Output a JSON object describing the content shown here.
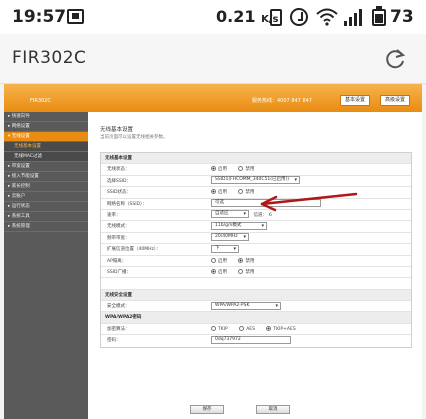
{
  "status_bar": {
    "time": "19:57",
    "speed_value": "0.21",
    "speed_unit": "K/s",
    "battery_percent": "73"
  },
  "browser": {
    "title": "FIR302C"
  },
  "router": {
    "model": "FIR302C",
    "hotline": "服务热线：4007 847 847",
    "header_buttons": [
      "基本设置",
      "高级设置"
    ],
    "accent_color": "#e98c12",
    "sidebar": [
      {
        "label": "▸ 快速向导",
        "state": "normal"
      },
      {
        "label": "▸ 网络设置",
        "state": "normal"
      },
      {
        "label": "▾ 无线设置",
        "state": "active"
      },
      {
        "label": "无线基本设置",
        "state": "sub-selected"
      },
      {
        "label": "无线MAC过滤",
        "state": "sub"
      },
      {
        "label": "▸ 带宽设置",
        "state": "normal"
      },
      {
        "label": "▸ 接入节能设置",
        "state": "normal"
      },
      {
        "label": "▸ 家长控制",
        "state": "normal"
      },
      {
        "label": "▸ 云账户",
        "state": "normal"
      },
      {
        "label": "▸ 运行状态",
        "state": "normal"
      },
      {
        "label": "▸ 系统工具",
        "state": "normal"
      },
      {
        "label": "▸ 系统管理",
        "state": "normal"
      }
    ],
    "page_title": "无线基本设置",
    "page_desc": "当前页面可以设置无线相关参数。",
    "sections": {
      "basic": "无线基本设置",
      "security": "无线安全设置",
      "wpa": "WPA/WPA2密码"
    },
    "fields": {
      "wireless_status": {
        "label": "无线状态：",
        "options": [
          "启用",
          "禁用"
        ],
        "selected": "启用"
      },
      "ssid_select": {
        "label": "选择SSID：",
        "value": "SSID1(FHCOMM_340C51(已启用))"
      },
      "ssid_status": {
        "label": "SSID状态：",
        "options": [
          "启用",
          "禁用"
        ],
        "selected": "启用"
      },
      "ssid_name": {
        "label": "网络名称（SSID）：",
        "value": "可选"
      },
      "rate": {
        "label": "速率：",
        "value": "自适应",
        "channel_label": "信道：",
        "channel_value": "6"
      },
      "mode": {
        "label": "无线模式：",
        "value": "11b/g/n模式"
      },
      "bandwidth": {
        "label": "频带带宽：",
        "value": "20/40MHz"
      },
      "ext_channel": {
        "label": "扩展信道位置（40MHz）：",
        "value": "下"
      },
      "ap_isolation": {
        "label": "AP隔离：",
        "options": [
          "启用",
          "禁用"
        ],
        "selected": "禁用"
      },
      "ssid_broadcast": {
        "label": "SSID广播：",
        "options": [
          "启用",
          "禁用"
        ],
        "selected": "启用"
      },
      "security_mode": {
        "label": "安全模式：",
        "value": "WPA/WPA2-PSK"
      },
      "encryption": {
        "label": "加密算法：",
        "options": [
          "TKIP",
          "AES",
          "TKIP+AES"
        ],
        "selected": "TKIP+AES"
      },
      "password": {
        "label": "密码：",
        "value": "0dq737972"
      }
    },
    "buttons": {
      "save": "保存",
      "cancel": "取消"
    }
  }
}
